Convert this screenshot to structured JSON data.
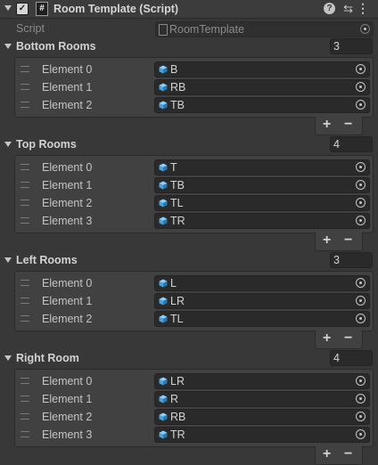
{
  "header": {
    "title": "Room Template (Script)",
    "script_icon_glyph": "#",
    "icons": [
      "help-icon",
      "preset-sliders-icon",
      "kebab-menu-icon"
    ]
  },
  "script": {
    "label": "Script",
    "value": "RoomTemplate"
  },
  "lists": [
    {
      "title": "Bottom Rooms",
      "size": "3",
      "items": [
        {
          "label": "Element 0",
          "value": "B"
        },
        {
          "label": "Element 1",
          "value": "RB"
        },
        {
          "label": "Element 2",
          "value": "TB"
        }
      ]
    },
    {
      "title": "Top Rooms",
      "size": "4",
      "items": [
        {
          "label": "Element 0",
          "value": "T"
        },
        {
          "label": "Element 1",
          "value": "TB"
        },
        {
          "label": "Element 2",
          "value": "TL"
        },
        {
          "label": "Element 3",
          "value": "TR"
        }
      ]
    },
    {
      "title": "Left Rooms",
      "size": "3",
      "items": [
        {
          "label": "Element 0",
          "value": "L"
        },
        {
          "label": "Element 1",
          "value": "LR"
        },
        {
          "label": "Element 2",
          "value": "TL"
        }
      ]
    },
    {
      "title": "Right Room",
      "size": "4",
      "items": [
        {
          "label": "Element 0",
          "value": "LR"
        },
        {
          "label": "Element 1",
          "value": "R"
        },
        {
          "label": "Element 2",
          "value": "RB"
        },
        {
          "label": "Element 3",
          "value": "TR"
        }
      ]
    }
  ],
  "footer": {
    "plus": "+",
    "minus": "−"
  },
  "colors": {
    "background": "#383838",
    "field": "#2a2a2a",
    "cube_icon": "#4aa3df"
  }
}
